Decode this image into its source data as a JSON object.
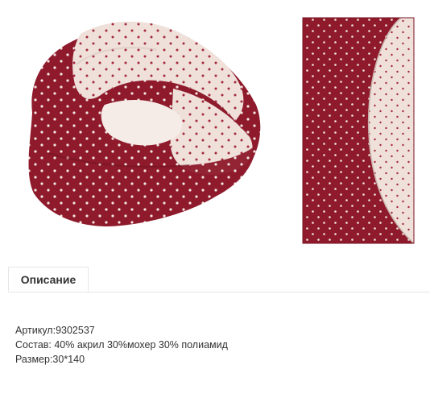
{
  "product": {
    "image_alt": "snood-scarf-photo",
    "colors": {
      "burgundy": "#8e1a2b",
      "cream": "#efe0da",
      "dot": "#f3e6e2"
    }
  },
  "tabs": [
    {
      "label": "Описание",
      "active": true
    }
  ],
  "description": {
    "article": "Артикул:9302537",
    "composition": "Состав: 40% акрил 30%мохер 30% полиамид",
    "size": "Размер:30*140"
  }
}
